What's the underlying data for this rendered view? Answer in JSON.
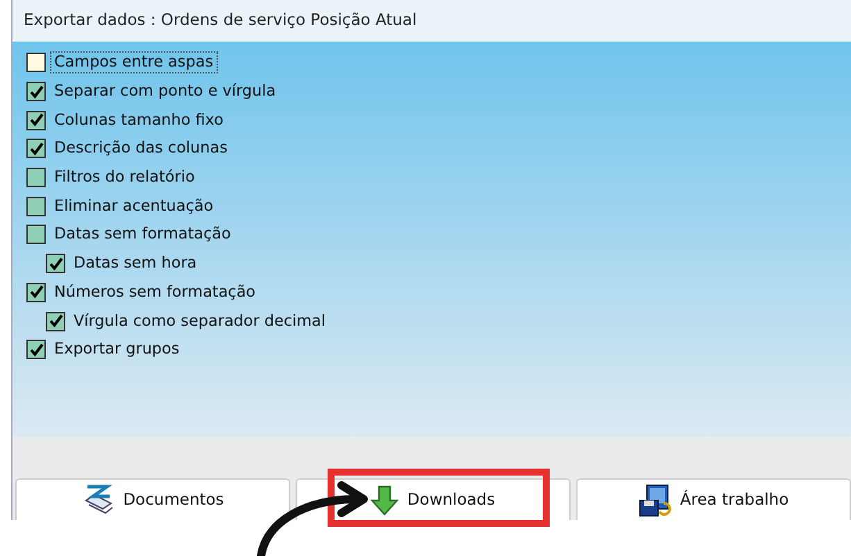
{
  "window": {
    "title": "Exportar dados : Ordens de serviço Posição Atual"
  },
  "options": [
    {
      "label": "Campos entre aspas",
      "checked": false,
      "focused": true
    },
    {
      "label": "Separar com ponto e vírgula",
      "checked": true,
      "focused": false
    },
    {
      "label": "Colunas tamanho fixo",
      "checked": true,
      "focused": false
    },
    {
      "label": "Descrição das colunas",
      "checked": true,
      "focused": false
    },
    {
      "label": "Filtros do relatório",
      "checked": false,
      "focused": false
    },
    {
      "label": "Eliminar acentuação",
      "checked": false,
      "focused": false
    },
    {
      "label": "Datas sem formatação",
      "checked": false,
      "focused": false,
      "children": [
        {
          "label": "Datas sem hora",
          "checked": true,
          "focused": false
        }
      ]
    },
    {
      "label": "Números sem formatação",
      "checked": true,
      "focused": false,
      "children": [
        {
          "label": "Vírgula como separador decimal",
          "checked": true,
          "focused": false
        }
      ]
    },
    {
      "label": "Exportar grupos",
      "checked": true,
      "focused": false
    }
  ],
  "buttons": [
    {
      "label": "Documentos",
      "kind": "documents",
      "highlighted": false
    },
    {
      "label": "Downloads",
      "kind": "downloads",
      "highlighted": true
    },
    {
      "label": "Área trabalho",
      "kind": "desktop",
      "highlighted": false
    }
  ]
}
